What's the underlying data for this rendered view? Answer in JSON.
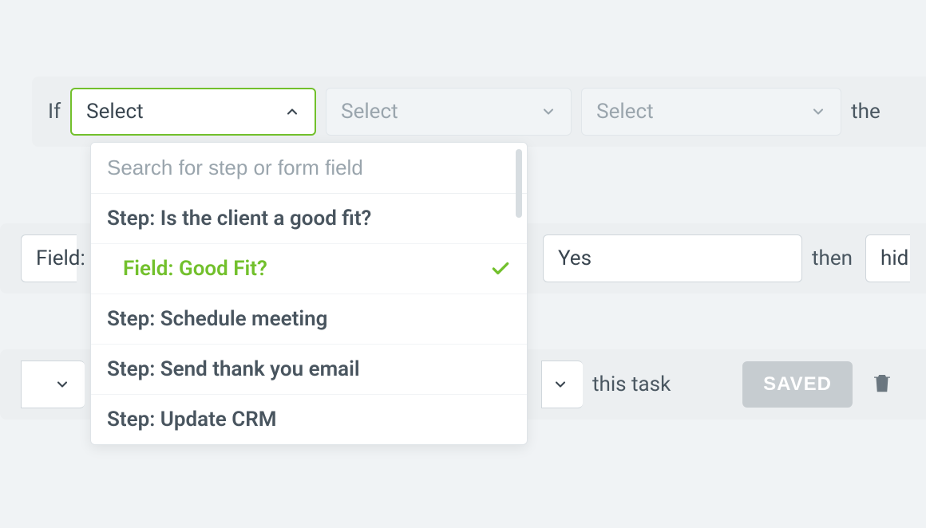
{
  "row1": {
    "if_label": "If",
    "select1_label": "Select",
    "select2_placeholder": "Select",
    "select3_placeholder": "Select",
    "then_label": "the"
  },
  "dropdown": {
    "search_placeholder": "Search for step or form field",
    "items": [
      {
        "label": "Step: Is the client a good fit?",
        "indented": false,
        "selected": false
      },
      {
        "label": "Field: Good Fit?",
        "indented": true,
        "selected": true
      },
      {
        "label": "Step: Schedule meeting",
        "indented": false,
        "selected": false
      },
      {
        "label": "Step: Send thank you email",
        "indented": false,
        "selected": false
      },
      {
        "label": "Step: Update CRM",
        "indented": false,
        "selected": false
      }
    ]
  },
  "row2": {
    "field_label": "Field:",
    "value": "Yes",
    "then_label": "then",
    "hide_label": "hid"
  },
  "row3": {
    "this_task_label": "this task",
    "saved_label": "SAVED"
  }
}
